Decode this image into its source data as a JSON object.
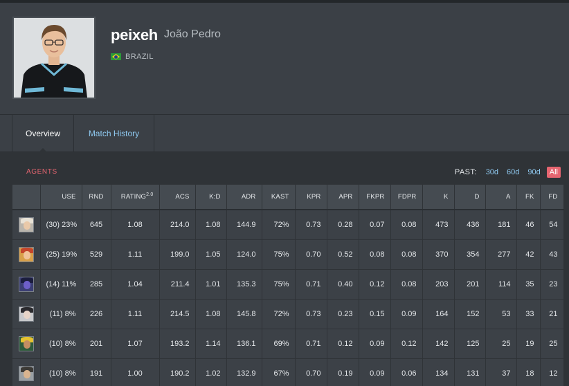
{
  "player": {
    "handle": "peixeh",
    "real_name": "João Pedro",
    "country": "BRAZIL"
  },
  "tabs": [
    {
      "label": "Overview",
      "active": true
    },
    {
      "label": "Match History",
      "active": false
    }
  ],
  "section_label": "AGENTS",
  "past": {
    "label": "PAST:",
    "ranges": [
      "30d",
      "60d",
      "90d",
      "All"
    ],
    "active": "All"
  },
  "columns": [
    "",
    "USE",
    "RND",
    "RATING",
    "ACS",
    "K:D",
    "ADR",
    "KAST",
    "KPR",
    "APR",
    "FKPR",
    "FDPR",
    "K",
    "D",
    "A",
    "FK",
    "FD"
  ],
  "rating_version": "2.0",
  "rows": [
    {
      "icon": "agent-icon-1",
      "use": "(30) 23%",
      "rnd": "645",
      "rating": "1.08",
      "acs": "214.0",
      "kd": "1.08",
      "adr": "144.9",
      "kast": "72%",
      "kpr": "0.73",
      "apr": "0.28",
      "fkpr": "0.07",
      "fdpr": "0.08",
      "k": "473",
      "d": "436",
      "a": "181",
      "fk": "46",
      "fd": "54"
    },
    {
      "icon": "agent-icon-2",
      "use": "(25) 19%",
      "rnd": "529",
      "rating": "1.11",
      "acs": "199.0",
      "kd": "1.05",
      "adr": "124.0",
      "kast": "75%",
      "kpr": "0.70",
      "apr": "0.52",
      "fkpr": "0.08",
      "fdpr": "0.08",
      "k": "370",
      "d": "354",
      "a": "277",
      "fk": "42",
      "fd": "43"
    },
    {
      "icon": "agent-icon-3",
      "use": "(14) 11%",
      "rnd": "285",
      "rating": "1.04",
      "acs": "211.4",
      "kd": "1.01",
      "adr": "135.3",
      "kast": "75%",
      "kpr": "0.71",
      "apr": "0.40",
      "fkpr": "0.12",
      "fdpr": "0.08",
      "k": "203",
      "d": "201",
      "a": "114",
      "fk": "35",
      "fd": "23"
    },
    {
      "icon": "agent-icon-4",
      "use": "(11) 8%",
      "rnd": "226",
      "rating": "1.11",
      "acs": "214.5",
      "kd": "1.08",
      "adr": "145.8",
      "kast": "72%",
      "kpr": "0.73",
      "apr": "0.23",
      "fkpr": "0.15",
      "fdpr": "0.09",
      "k": "164",
      "d": "152",
      "a": "53",
      "fk": "33",
      "fd": "21"
    },
    {
      "icon": "agent-icon-5",
      "use": "(10) 8%",
      "rnd": "201",
      "rating": "1.07",
      "acs": "193.2",
      "kd": "1.14",
      "adr": "136.1",
      "kast": "69%",
      "kpr": "0.71",
      "apr": "0.12",
      "fkpr": "0.09",
      "fdpr": "0.12",
      "k": "142",
      "d": "125",
      "a": "25",
      "fk": "19",
      "fd": "25"
    },
    {
      "icon": "agent-icon-6",
      "use": "(10) 8%",
      "rnd": "191",
      "rating": "1.00",
      "acs": "190.2",
      "kd": "1.02",
      "adr": "132.9",
      "kast": "67%",
      "kpr": "0.70",
      "apr": "0.19",
      "fkpr": "0.09",
      "fdpr": "0.06",
      "k": "134",
      "d": "131",
      "a": "37",
      "fk": "18",
      "fd": "12"
    }
  ],
  "icon_colors": {
    "agent-icon-1": {
      "bg": "#b9b5ad",
      "hair": "#e8e2d6",
      "face": "#e9c9a9"
    },
    "agent-icon-2": {
      "bg": "#d8a04a",
      "hair": "#c4462c",
      "face": "#f0c39a"
    },
    "agent-icon-3": {
      "bg": "#3b3f73",
      "hair": "#1b1d3e",
      "face": "#6d5fc9"
    },
    "agent-icon-4": {
      "bg": "#c8c9cc",
      "hair": "#2a2a2e",
      "face": "#e7d4c8"
    },
    "agent-icon-5": {
      "bg": "#2f5a3b",
      "hair": "#e6c231",
      "face": "#c48d62"
    },
    "agent-icon-6": {
      "bg": "#9aa0a4",
      "hair": "#3c3a36",
      "face": "#d9b48f"
    }
  },
  "colors": {
    "accent": "#e66570",
    "link": "#8fc9f0"
  }
}
